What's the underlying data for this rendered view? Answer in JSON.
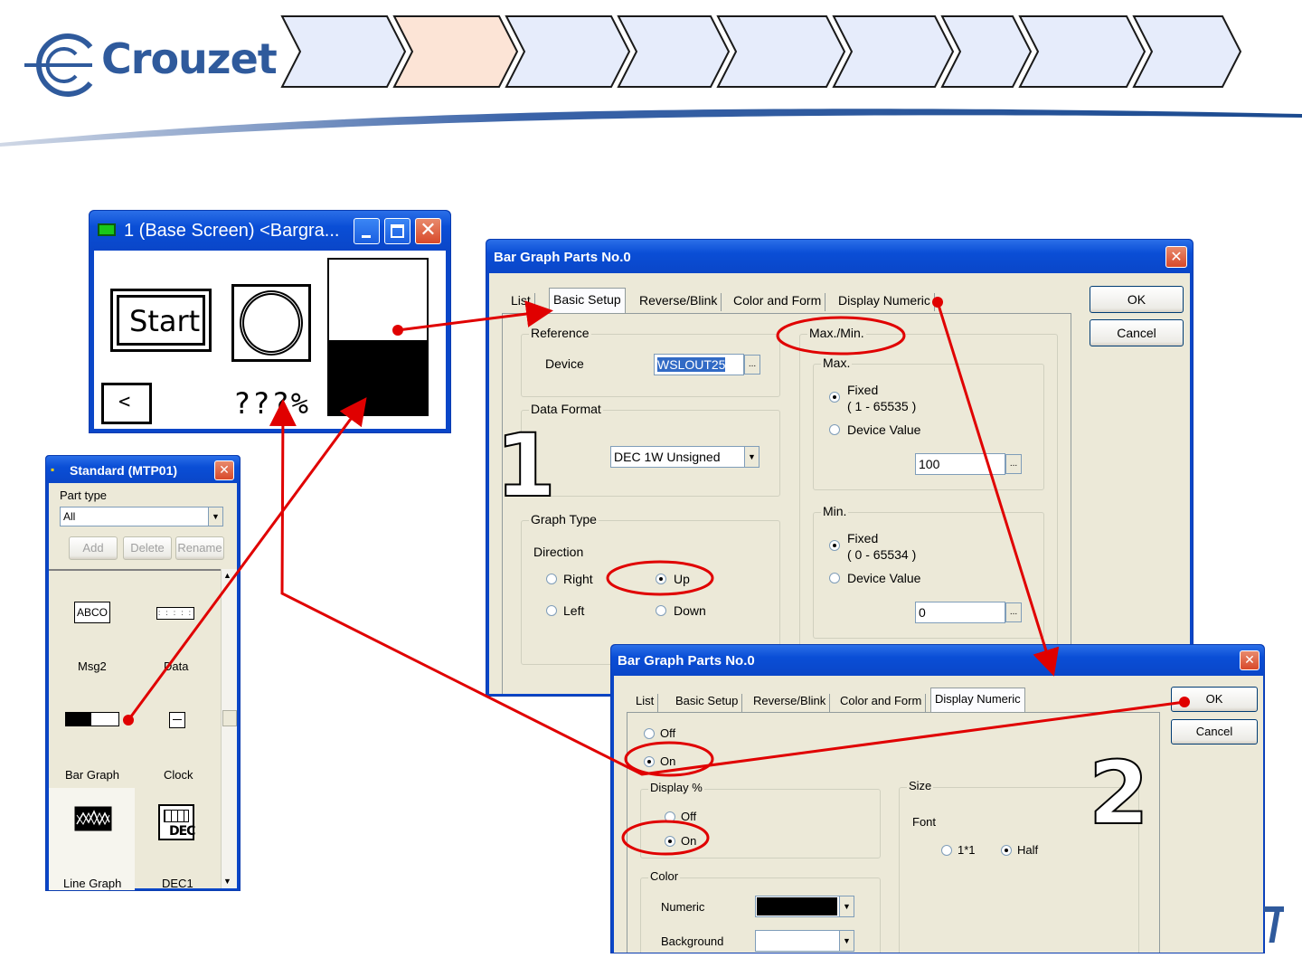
{
  "brand": {
    "name": "Crouzet"
  },
  "breadcrumb_steps": 9,
  "base_window": {
    "title": "1 (Base Screen) <Bargra...",
    "start_label": "Start",
    "back_label": "<",
    "percent_label": "???%",
    "bar_fill_fraction": 0.48
  },
  "parts_window": {
    "title": "Standard (MTP01)",
    "part_type_label": "Part type",
    "part_type_value": "All",
    "buttons": [
      "Add",
      "Delete",
      "Rename"
    ],
    "items": [
      {
        "label": "Msg2",
        "icon": "abco-msg-icon",
        "icon_text": "ABCO"
      },
      {
        "label": "Data",
        "icon": "data-display-icon"
      },
      {
        "label": "Bar Graph",
        "icon": "bar-graph-icon"
      },
      {
        "label": "Clock",
        "icon": "clock-icon"
      },
      {
        "label": "Line Graph",
        "icon": "line-graph-icon"
      },
      {
        "label": "DEC1",
        "icon": "dec-icon",
        "icon_text": "DEC"
      }
    ]
  },
  "dialog1": {
    "title": "Bar Graph Parts No.0",
    "tabs": [
      "List",
      "Basic Setup",
      "Reverse/Blink",
      "Color and Form",
      "Display Numeric"
    ],
    "active_tab": "Basic Setup",
    "reference": {
      "group_label": "Reference",
      "device_label": "Device",
      "device_value": "WSLOUT25"
    },
    "data_format": {
      "group_label": "Data Format",
      "value": "DEC 1W Unsigned"
    },
    "graph_type": {
      "group_label": "Graph Type",
      "direction_label": "Direction",
      "options": {
        "right": "Right",
        "up": "Up",
        "left": "Left",
        "down": "Down"
      },
      "selected": "Up"
    },
    "maxmin": {
      "group_label": "Max./Min.",
      "max": {
        "group_label": "Max.",
        "fixed_label": "Fixed",
        "fixed_range": "( 1 - 65535 )",
        "device_label": "Device Value",
        "value": "100"
      },
      "min": {
        "group_label": "Min.",
        "fixed_label": "Fixed",
        "fixed_range": "( 0 - 65534 )",
        "device_label": "Device Value",
        "value": "0"
      }
    },
    "ok_label": "OK",
    "cancel_label": "Cancel",
    "step_number": "1"
  },
  "dialog2": {
    "title": "Bar Graph Parts No.0",
    "tabs": [
      "List",
      "Basic Setup",
      "Reverse/Blink",
      "Color and Form",
      "Display Numeric"
    ],
    "active_tab": "Display Numeric",
    "display": {
      "off_label": "Off",
      "on_label": "On",
      "selected": "On"
    },
    "display_percent": {
      "group_label": "Display %",
      "off_label": "Off",
      "on_label": "On",
      "selected": "On"
    },
    "size": {
      "group_label": "Size",
      "font_label": "Font",
      "option_1": "1*1",
      "option_half": "Half",
      "selected": "Half"
    },
    "color": {
      "group_label": "Color",
      "numeric_label": "Numeric",
      "background_label": "Background",
      "numeric_color": "#000000",
      "background_color": "#ffffff"
    },
    "ok_label": "OK",
    "cancel_label": "Cancel",
    "step_number": "2"
  },
  "colors": {
    "annotation_red": "#e00000",
    "xp_title_blue": "#0a4ed6",
    "chevron_fill": "#e6ecfb",
    "chevron_active_fill": "#fce4d6",
    "brand_blue": "#2f5a9c"
  }
}
